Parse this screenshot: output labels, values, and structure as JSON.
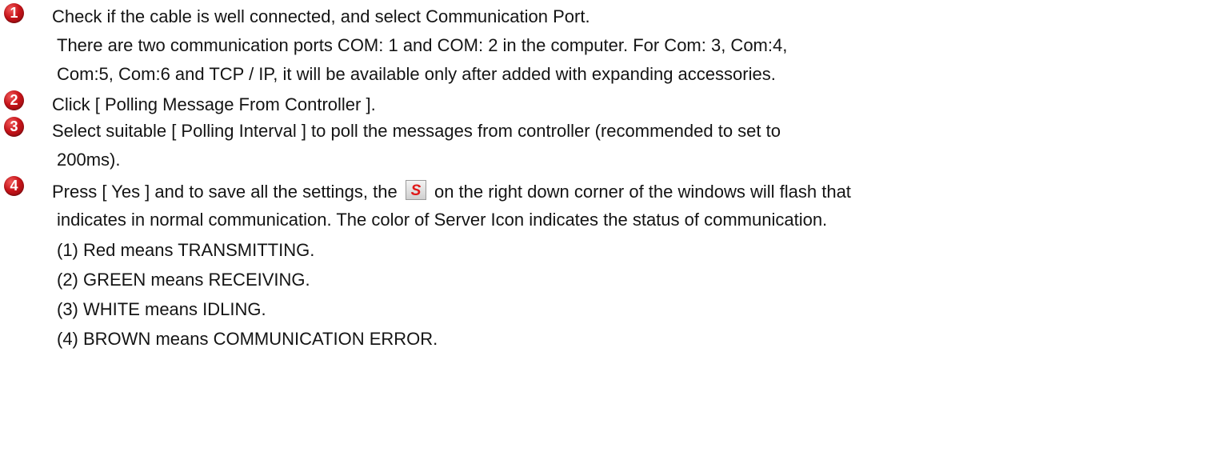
{
  "steps": [
    {
      "number": "1",
      "lines": [
        "Check if the cable is well connected, and select Communication Port.",
        "There are two communication ports COM: 1 and COM: 2 in the computer. For Com: 3, Com:4,",
        "Com:5, Com:6 and TCP / IP, it will be available only after added with expanding accessories."
      ]
    },
    {
      "number": "2",
      "lines": [
        "Click [ Polling Message From Controller ]."
      ]
    },
    {
      "number": "3",
      "lines": [
        "Select suitable [ Polling Interval ] to poll the messages from controller (recommended to set to",
        "200ms)."
      ]
    },
    {
      "number": "4",
      "line1_before_icon": "Press [ Yes ] and to save all the settings, the",
      "icon_letter": "S",
      "line1_after_icon": "on the right down corner of the windows will flash that",
      "lines": [
        "indicates in normal communication. The color of Server Icon indicates the status of communication."
      ],
      "status_list": [
        "(1) Red means TRANSMITTING.",
        "(2) GREEN means RECEIVING.",
        "(3) WHITE means IDLING.",
        "(4) BROWN means COMMUNICATION ERROR."
      ]
    }
  ],
  "icons": {
    "step_badge": "numbered-circle-icon",
    "server": "server-s-icon"
  },
  "colors": {
    "badge_red": "#c8141a",
    "server_icon_red": "#e01818",
    "text": "#141414"
  }
}
